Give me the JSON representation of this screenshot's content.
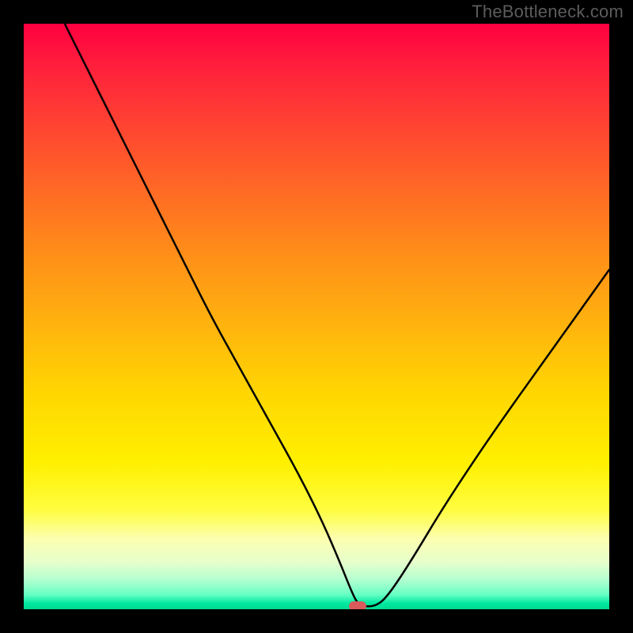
{
  "watermark": "TheBottleneck.com",
  "chart_data": {
    "type": "line",
    "title": "",
    "xlabel": "",
    "ylabel": "",
    "xlim": [
      0,
      100
    ],
    "ylim": [
      0,
      100
    ],
    "grid": false,
    "legend": false,
    "series": [
      {
        "name": "bottleneck-curve",
        "x": [
          7,
          12,
          17,
          22,
          27,
          32,
          37,
          42,
          47,
          51,
          54,
          56,
          57,
          58,
          60,
          62,
          66,
          72,
          80,
          90,
          100
        ],
        "values": [
          100,
          90,
          80,
          70,
          60,
          50,
          41,
          32,
          23,
          15,
          8,
          3,
          1,
          0.5,
          0.5,
          2,
          8,
          18,
          30,
          44,
          58
        ]
      }
    ],
    "marker": {
      "x": 57,
      "y": 0.5
    },
    "background_gradient": {
      "top": "#ff0040",
      "mid": "#fff000",
      "bottom": "#00d890"
    }
  }
}
